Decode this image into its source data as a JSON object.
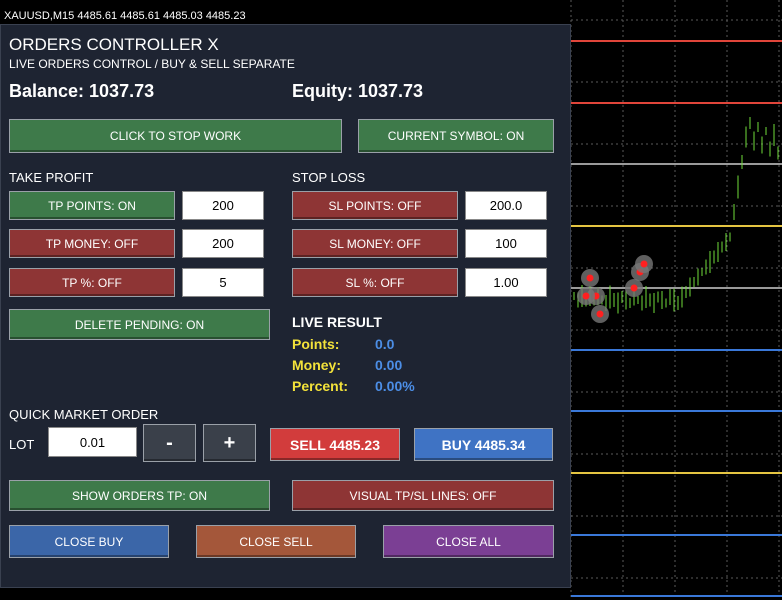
{
  "chart": {
    "ticker": "XAUUSD,M15",
    "ohlc": "4485.61 4485.61 4485.03 4485.23",
    "colors": {
      "up": "#6fdc3a",
      "marker": "#ff2020"
    }
  },
  "panel": {
    "title": "ORDERS CONTROLLER X",
    "subtitle": "LIVE ORDERS CONTROL / BUY & SELL SEPARATE",
    "balance_label": "Balance: 1037.73",
    "equity_label": "Equity: 1037.73",
    "stop_work": "CLICK TO STOP WORK",
    "current_symbol": "CURRENT SYMBOL: ON",
    "tp": {
      "header": "TAKE PROFIT",
      "points": {
        "label": "TP POINTS: ON",
        "value": "200"
      },
      "money": {
        "label": "TP MONEY: OFF",
        "value": "200"
      },
      "percent": {
        "label": "TP %: OFF",
        "value": "5"
      }
    },
    "sl": {
      "header": "STOP LOSS",
      "points": {
        "label": "SL POINTS: OFF",
        "value": "200.0"
      },
      "money": {
        "label": "SL MONEY: OFF",
        "value": "100"
      },
      "percent": {
        "label": "SL %: OFF",
        "value": "1.00"
      }
    },
    "delete_pending": "DELETE PENDING: ON",
    "live": {
      "header": "LIVE RESULT",
      "points_label": "Points:",
      "points_value": "0.0",
      "money_label": "Money:",
      "money_value": "0.00",
      "percent_label": "Percent:",
      "percent_value": "0.00%"
    },
    "quick": {
      "header": "QUICK MARKET ORDER",
      "lot_label": "LOT",
      "lot_value": "0.01",
      "minus": "-",
      "plus": "+",
      "sell": "SELL  4485.23",
      "buy": "BUY  4485.34"
    },
    "show_tp": "SHOW ORDERS TP: ON",
    "visual_lines": "VISUAL TP/SL LINES: OFF",
    "close_buy": "CLOSE BUY",
    "close_sell": "CLOSE SELL",
    "close_all": "CLOSE ALL"
  }
}
